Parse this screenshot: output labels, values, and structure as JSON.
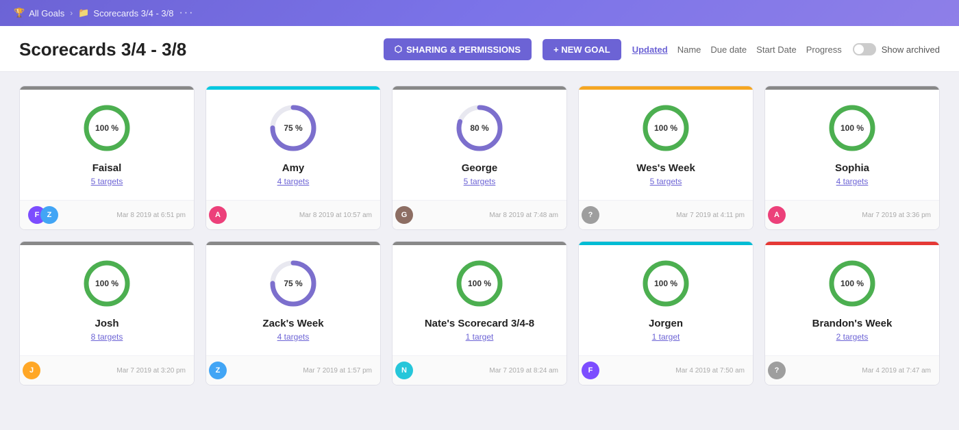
{
  "nav": {
    "all_goals": "All Goals",
    "scorecard": "Scorecards 3/4 - 3/8",
    "dots": "···"
  },
  "header": {
    "title": "Scorecards 3/4 - 3/8",
    "sharing_btn": "SHARING & PERMISSIONS",
    "new_goal_btn": "+ NEW GOAL",
    "sort_options": [
      "Updated",
      "Name",
      "Due date",
      "Start Date",
      "Progress"
    ],
    "active_sort": "Updated",
    "show_archived": "Show archived"
  },
  "cards": [
    {
      "id": "faisal",
      "name": "Faisal",
      "targets": "5 targets",
      "progress": 100,
      "color": "green",
      "top_bar": "gray",
      "date": "Mar 8 2019 at 6:51 pm",
      "avatars": [
        "av-purple",
        "av-blue"
      ]
    },
    {
      "id": "amy",
      "name": "Amy",
      "targets": "4 targets",
      "progress": 75,
      "color": "purple",
      "top_bar": "cyan",
      "date": "Mar 8 2019 at 10:57 am",
      "avatars": [
        "av-pink"
      ]
    },
    {
      "id": "george",
      "name": "George",
      "targets": "5 targets",
      "progress": 80,
      "color": "purple",
      "top_bar": "gray",
      "date": "Mar 8 2019 at 7:48 am",
      "avatars": [
        "av-brown"
      ]
    },
    {
      "id": "wess-week",
      "name": "Wes's Week",
      "targets": "5 targets",
      "progress": 100,
      "color": "green",
      "top_bar": "orange",
      "date": "Mar 7 2019 at 4:11 pm",
      "avatars": [
        "av-gray"
      ]
    },
    {
      "id": "sophia",
      "name": "Sophia",
      "targets": "4 targets",
      "progress": 100,
      "color": "green",
      "top_bar": "gray",
      "date": "Mar 7 2019 at 3:36 pm",
      "avatars": [
        "av-pink"
      ]
    },
    {
      "id": "josh",
      "name": "Josh",
      "targets": "8 targets",
      "progress": 100,
      "color": "green",
      "top_bar": "gray",
      "date": "Mar 7 2019 at 3:20 pm",
      "avatars": [
        "av-orange"
      ]
    },
    {
      "id": "zacks-week",
      "name": "Zack's Week",
      "targets": "4 targets",
      "progress": 75,
      "color": "purple",
      "top_bar": "gray",
      "date": "Mar 7 2019 at 1:57 pm",
      "avatars": [
        "av-blue"
      ]
    },
    {
      "id": "nates-scorecard",
      "name": "Nate's Scorecard 3/4-8",
      "targets": "1 target",
      "progress": 100,
      "color": "green",
      "top_bar": "gray",
      "date": "Mar 7 2019 at 8:24 am",
      "avatars": [
        "av-teal"
      ]
    },
    {
      "id": "jorgen",
      "name": "Jorgen",
      "targets": "1 target",
      "progress": 100,
      "color": "green",
      "top_bar": "teal",
      "date": "Mar 4 2019 at 7:50 am",
      "avatars": [
        "av-purple"
      ]
    },
    {
      "id": "brandons-week",
      "name": "Brandon's Week",
      "targets": "2 targets",
      "progress": 100,
      "color": "green",
      "top_bar": "red",
      "date": "Mar 4 2019 at 7:47 am",
      "avatars": [
        "av-gray"
      ]
    }
  ]
}
